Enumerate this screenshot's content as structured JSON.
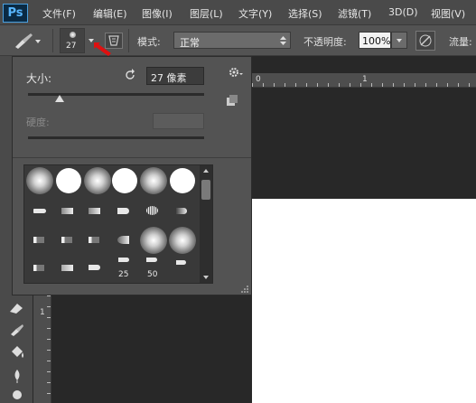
{
  "app": {
    "logo": "Ps"
  },
  "menu": [
    "文件(F)",
    "编辑(E)",
    "图像(I)",
    "图层(L)",
    "文字(Y)",
    "选择(S)",
    "滤镜(T)",
    "3D(D)",
    "视图(V)"
  ],
  "options_bar": {
    "brush_size": "27",
    "mode_label": "模式:",
    "mode_value": "正常",
    "opacity_label": "不透明度:",
    "opacity_value": "100%",
    "flow_label": "流量:"
  },
  "brush_panel": {
    "size_label": "大小:",
    "size_value": "27 像素",
    "size_slider_value": 0.18,
    "hardness_label": "硬度:",
    "brush_numbers": [
      "25",
      "50"
    ]
  },
  "rulers": {
    "top_marks": [
      "0",
      "1"
    ],
    "left_mark": "1"
  },
  "icons": [
    "brush-tool-icon",
    "dropdown-arrow-icon",
    "brush-panel-toggle-icon",
    "reset-icon",
    "gear-icon",
    "new-preset-icon",
    "scroll-up-icon",
    "scroll-down-icon",
    "resize-grip-icon",
    "pressure-icon"
  ]
}
